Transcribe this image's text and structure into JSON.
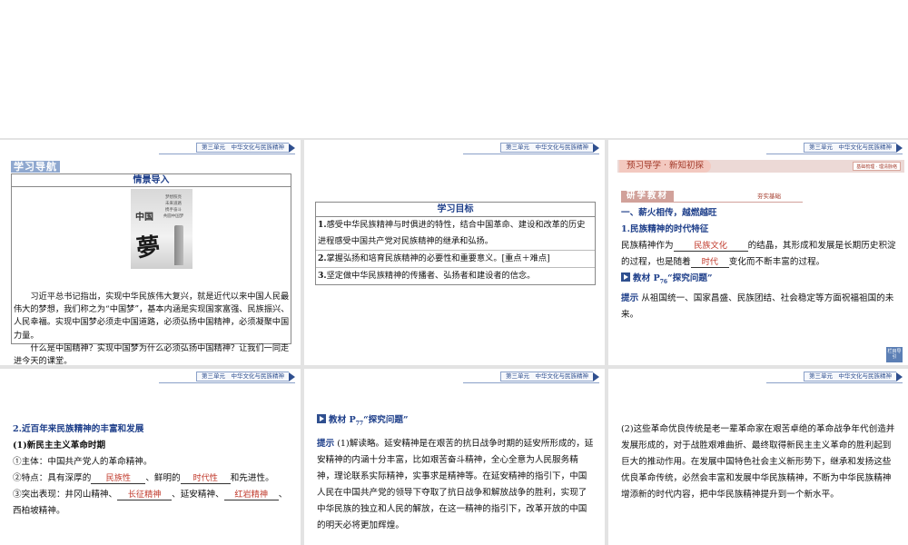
{
  "header": "第三单元　中华文化与民族精神",
  "slide1": {
    "banner": "学习导航",
    "box_title": "情景导入",
    "image": {
      "poem_lines": [
        "梦想照亮",
        "未来道路",
        "携手奋斗",
        "共圆中国梦"
      ],
      "seal": "中国",
      "char": "夢"
    },
    "para1": "习近平总书记指出，实现中华民族伟大复兴，就是近代以来中国人民最伟大的梦想，我们称之为“中国梦”，基本内涵是实现国家富强、民族振兴、人民幸福。实现中国梦必须走中国道路，必须弘扬中国精神，必须凝聚中国力量。",
    "para2": "什么是中国精神？实现中国梦为什么必须弘扬中国精神？让我们一同走进今天的课堂。"
  },
  "slide2": {
    "box_title": "学习目标",
    "items": [
      {
        "num": "1.",
        "text": "感受中华民族精神与时俱进的特性，结合中国革命、建设和改革的历史进程感受中国共产党对民族精神的继承和弘扬。"
      },
      {
        "num": "2.",
        "text": "掌握弘扬和培育民族精神的必要性和重要意义。[重点＋难点]"
      },
      {
        "num": "3.",
        "text": "坚定做中华民族精神的传播者、弘扬者和建设者的信念。"
      }
    ]
  },
  "slide3": {
    "preview": "预习导学 · 新知初探",
    "tag": "基础梳理 · 理清脉络",
    "study": "研学教材",
    "study_right": "夯实基础",
    "heading1": "一、薪火相传，越燃越旺",
    "heading2": "1.民族精神的时代特征",
    "line1_a": "民族精神作为",
    "blank1": "民族文化",
    "line1_b": "的结晶，其形成和发展是长期历史积淀的过程，也是随着",
    "blank2": "时代",
    "line1_c": "变化而不断丰富的过程。",
    "material_a": "教材 P",
    "material_sub": "76",
    "material_b": "“探究问题”",
    "hint_label": "提示",
    "hint_text": "从祖国统一、国家昌盛、民族团结、社会稳定等方面祝福祖国的未来。",
    "nav_label": "栏目导引"
  },
  "slide4": {
    "heading": "2.近百年来民族精神的丰富和发展",
    "sub": "(1)新民主主义革命时期",
    "l1": "①主体：中国共产党人的革命精神。",
    "l2_a": "②特点：具有深厚的",
    "blank1": "民族性",
    "l2_b": "、鲜明的",
    "blank2": "时代性",
    "l2_c": "和先进性。",
    "l3_a": "③突出表现：井冈山精神、",
    "blank3": "长征精神",
    "l3_b": "、延安精神、",
    "blank4": "红岩精神",
    "l3_c": "、西柏坡精神。"
  },
  "slide5": {
    "material_a": "教材 P",
    "material_sub": "77",
    "material_b": "“探究问题”",
    "hint_label": "提示",
    "text": "(1)解读略。延安精神是在艰苦的抗日战争时期的延安所形成的，延安精神的内涵十分丰富，比如艰苦奋斗精神，全心全意为人民服务精神，理论联系实际精神，实事求是精神等。在延安精神的指引下，中国人民在中国共产党的领导下夺取了抗日战争和解放战争的胜利，实现了中华民族的独立和人民的解放，在这一精神的指引下，改革开放的中国的明天必将更加辉煌。"
  },
  "slide6": {
    "text": "(2)这些革命优良传统是老一辈革命家在艰苦卓绝的革命战争年代创造并发展形成的，对于战胜艰难曲折、最终取得新民主主义革命的胜利起到巨大的推动作用。在发展中国特色社会主义新形势下，继承和发扬这些优良革命传统，必然会丰富和发展中华民族精神，不断为中华民族精神增添新的时代内容，把中华民族精神提升到一个新水平。"
  }
}
